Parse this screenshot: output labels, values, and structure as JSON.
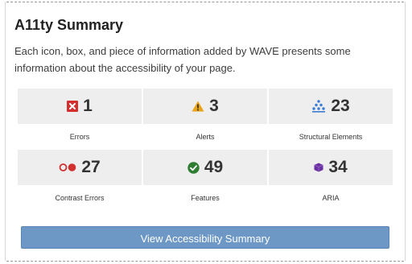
{
  "summary": {
    "title": "A11ty Summary",
    "description": "Each icon, box, and piece of information added by WAVE presents some information about the accessibility of your page."
  },
  "stats": {
    "errors": {
      "count": "1",
      "label": "Errors",
      "icon": "error-icon",
      "color": "#d32f2f"
    },
    "alerts": {
      "count": "3",
      "label": "Alerts",
      "icon": "alert-triangle-icon",
      "color": "#e8a317"
    },
    "structure": {
      "count": "23",
      "label": "Structural Elements",
      "icon": "structure-tree-icon",
      "color": "#3a7bd5"
    },
    "contrast": {
      "count": "27",
      "label": "Contrast Errors",
      "icon": "contrast-icon",
      "color": "#d32f2f"
    },
    "features": {
      "count": "49",
      "label": "Features",
      "icon": "check-circle-icon",
      "color": "#2e7d32"
    },
    "aria": {
      "count": "34",
      "label": "ARIA",
      "icon": "aria-cube-icon",
      "color": "#6a2fa0"
    }
  },
  "actions": {
    "view_summary_label": "View Accessibility Summary",
    "button_color": "#6d97c4"
  }
}
